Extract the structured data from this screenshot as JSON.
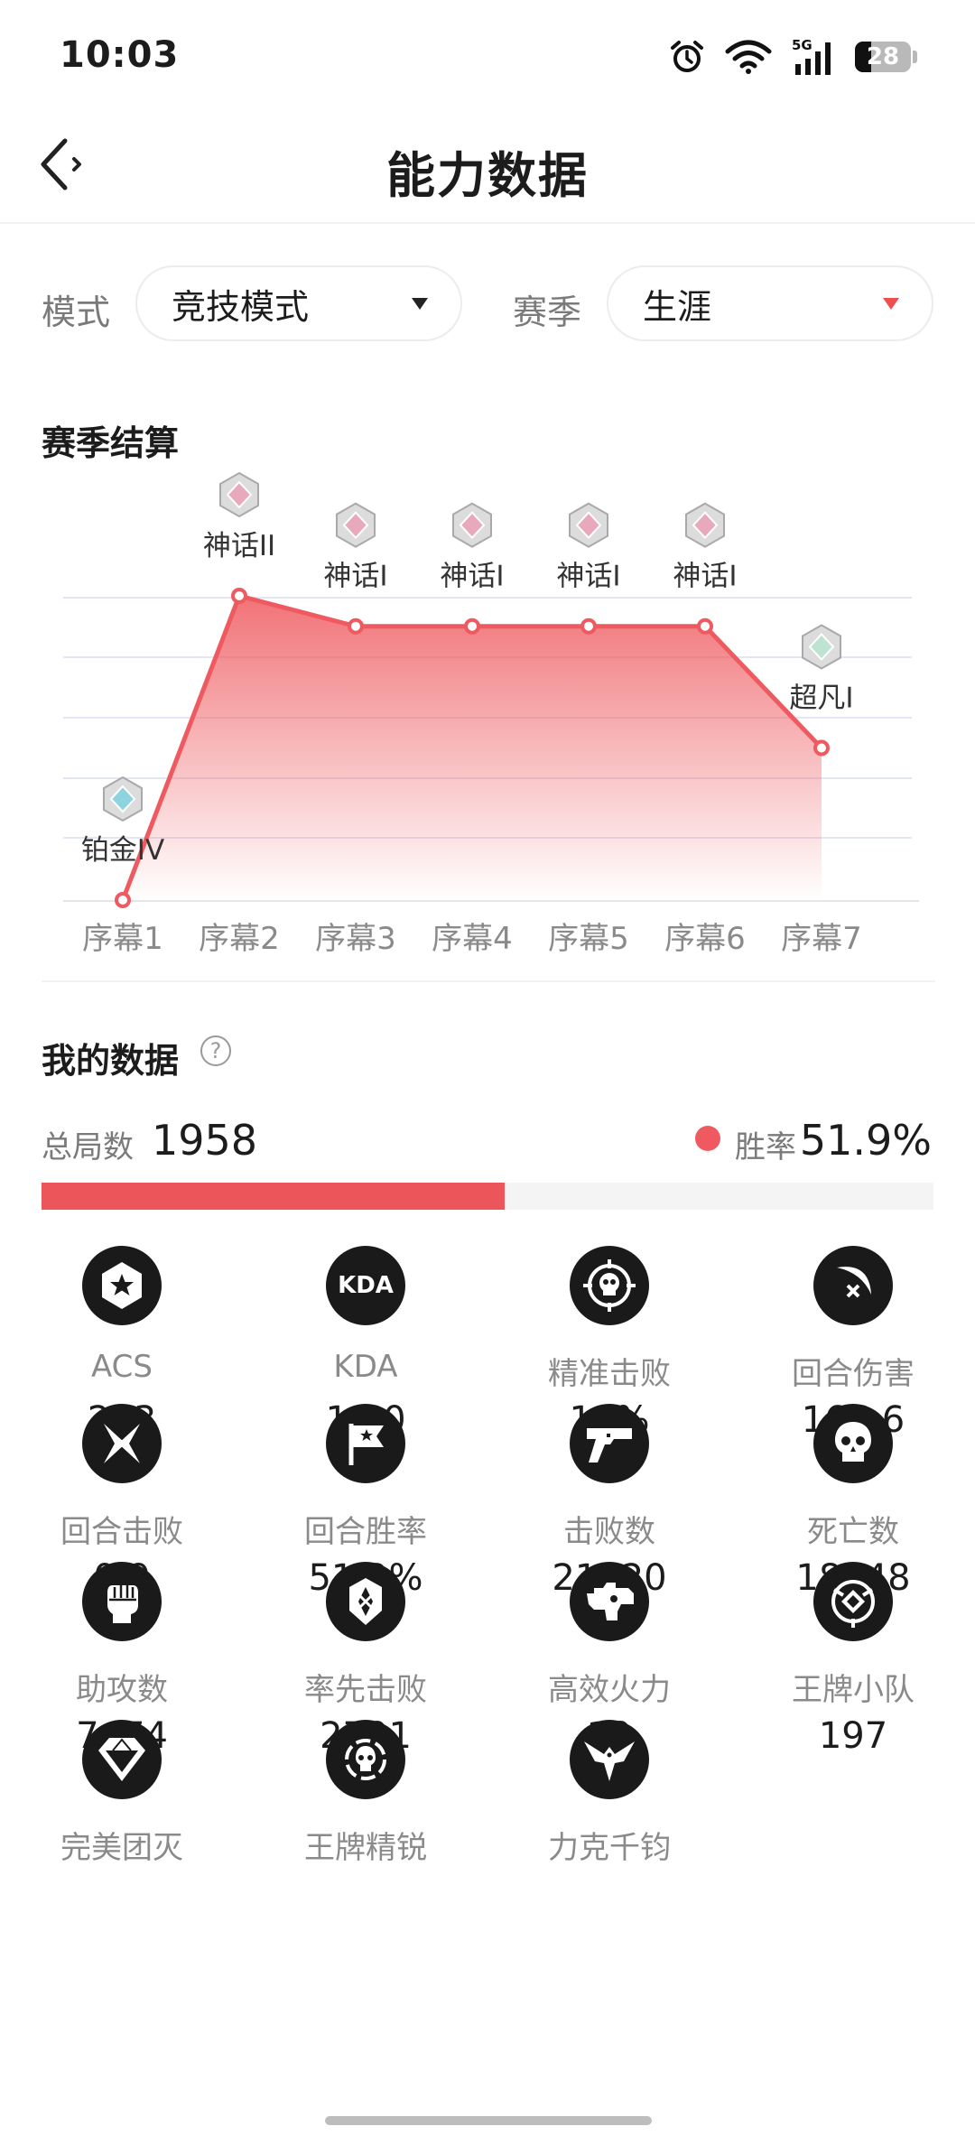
{
  "status_bar": {
    "time": "10:03",
    "battery": "28",
    "network": "5G"
  },
  "header": {
    "title": "能力数据"
  },
  "filters": {
    "mode_label": "模式",
    "mode_value": "竞技模式",
    "season_label": "赛季",
    "season_value": "生涯"
  },
  "season_section": {
    "title": "赛季结算"
  },
  "chart_data": {
    "type": "area",
    "x": [
      "序幕1",
      "序幕2",
      "序幕3",
      "序幕4",
      "序幕5",
      "序幕6",
      "序幕7"
    ],
    "ranks": [
      "铂金IV",
      "神话II",
      "神话I",
      "神话I",
      "神话I",
      "神话I",
      "超凡I"
    ],
    "rank_colors": [
      "#8fd3e0",
      "#e9a9bd",
      "#e9a9bd",
      "#e9a9bd",
      "#e9a9bd",
      "#e9a9bd",
      "#bfe3d2"
    ],
    "values": [
      0,
      5,
      4.5,
      4.5,
      4.5,
      4.5,
      2.5
    ],
    "ylim": [
      0,
      5
    ],
    "grid": true,
    "line_color": "#ee5a5f"
  },
  "my_data": {
    "title": "我的数据",
    "help": "?",
    "total_label": "总局数",
    "total_value": "1958",
    "win_label": "胜率",
    "win_value": "51.9%",
    "win_rate": 0.519
  },
  "stats": [
    {
      "label": "ACS",
      "value": "293",
      "icon": "star-shield-icon"
    },
    {
      "label": "KDA",
      "value": "1.60",
      "icon": "kda-icon",
      "icon_text": "KDA"
    },
    {
      "label": "精准击败",
      "value": "19%",
      "icon": "crosshair-skull-icon"
    },
    {
      "label": "回合伤害",
      "value": "166.6",
      "icon": "slash-damage-icon"
    },
    {
      "label": "回合击败",
      "value": "0.9",
      "icon": "crossed-blades-icon"
    },
    {
      "label": "回合胜率",
      "value": "51.2%",
      "icon": "flag-icon"
    },
    {
      "label": "击败数",
      "value": "21920",
      "icon": "pistol-icon"
    },
    {
      "label": "死亡数",
      "value": "18348",
      "icon": "skull-icon"
    },
    {
      "label": "助攻数",
      "value": "7474",
      "icon": "fist-icon"
    },
    {
      "label": "率先击败",
      "value": "2701",
      "icon": "first-blood-icon"
    },
    {
      "label": "高效火力",
      "value": "19",
      "icon": "firepower-icon"
    },
    {
      "label": "王牌小队",
      "value": "197",
      "icon": "ace-squad-icon"
    },
    {
      "label": "完美团灭",
      "value": "",
      "icon": "diamond-icon"
    },
    {
      "label": "王牌精锐",
      "value": "",
      "icon": "ace-elite-icon"
    },
    {
      "label": "力克千钧",
      "value": "",
      "icon": "eagle-icon"
    }
  ]
}
